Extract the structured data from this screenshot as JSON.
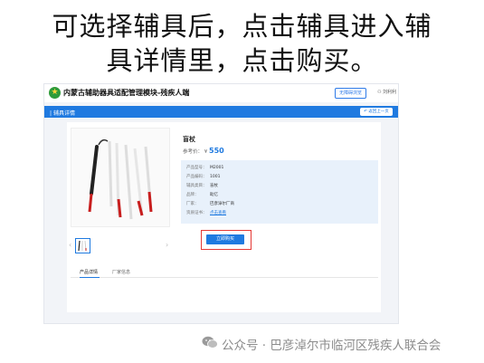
{
  "slide": {
    "title_line1": "可选择辅具后，点击辅具进入辅",
    "title_line2": "具详情里，点击购买。"
  },
  "app": {
    "logo_glyph": "★",
    "title": "内蒙古辅助器具适配管理模块-残疾人端",
    "obstacle_button": "无障碍浏览",
    "user": "刘利利"
  },
  "bar": {
    "title": "辅具详情",
    "back_label": "返回上一页"
  },
  "product": {
    "name": "盲杖",
    "price_label": "参考价：",
    "currency": "¥",
    "price": "550",
    "info": [
      {
        "key": "产品型号：",
        "value": "M2001"
      },
      {
        "key": "产品编码：",
        "value": "1001"
      },
      {
        "key": "辅具类目：",
        "value": "盲杖"
      },
      {
        "key": "品牌：",
        "value": "助亿"
      },
      {
        "key": "厂家：",
        "value": "巴彦淖尔厂商"
      },
      {
        "key": "资质证书：",
        "value": "点击查看",
        "link": true
      }
    ],
    "buy_label": "立即购买"
  },
  "tabs": [
    {
      "label": "产品详情",
      "active": true
    },
    {
      "label": "厂家信息",
      "active": false
    }
  ],
  "watermark": {
    "text": "公众号 · 巴彦淖尔市临河区残疾人联合会"
  },
  "colors": {
    "accent": "#1f7ae0",
    "highlight": "#e53935",
    "info_bg": "#e8f1fb"
  }
}
